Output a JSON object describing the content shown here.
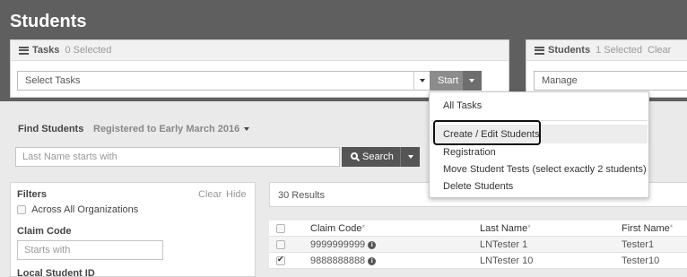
{
  "page": {
    "title": "Students"
  },
  "tasks_panel": {
    "title": "Tasks",
    "selected": "0 Selected",
    "select_placeholder": "Select Tasks",
    "start_label": "Start"
  },
  "students_panel": {
    "title": "Students",
    "selected": "1 Selected",
    "clear": "Clear",
    "manage_label": "Manage"
  },
  "find": {
    "label": "Find Students",
    "registered": "Registered to Early March 2016",
    "search_placeholder": "Last Name starts with",
    "search_label": "Search"
  },
  "filters": {
    "title": "Filters",
    "clear": "Clear",
    "hide": "Hide",
    "across_all": "Across All Organizations",
    "claim_code_label": "Claim Code",
    "claim_code_placeholder": "Starts with",
    "local_id_label": "Local Student ID"
  },
  "results": {
    "count": "30 Results",
    "columns": [
      "Claim Code",
      "Last Name",
      "First Name"
    ],
    "required_marker": "*",
    "rows": [
      {
        "checked": false,
        "claim_code": "9999999999",
        "last_name": "LNTester 1",
        "first_name": "Tester1"
      },
      {
        "checked": true,
        "claim_code": "9888888888",
        "last_name": "LNTester 10",
        "first_name": "Tester10"
      }
    ]
  },
  "dropdown_menu": {
    "items": [
      "All Tasks",
      "Create / Edit Students",
      "Registration",
      "Move Student Tests (select exactly 2 students)",
      "Delete Students"
    ],
    "highlighted_index": 1
  },
  "colors": {
    "header_bg": "#5f5f5f",
    "start_button": "#8c8c8c",
    "search_button": "#555555",
    "outline": "#111111"
  }
}
